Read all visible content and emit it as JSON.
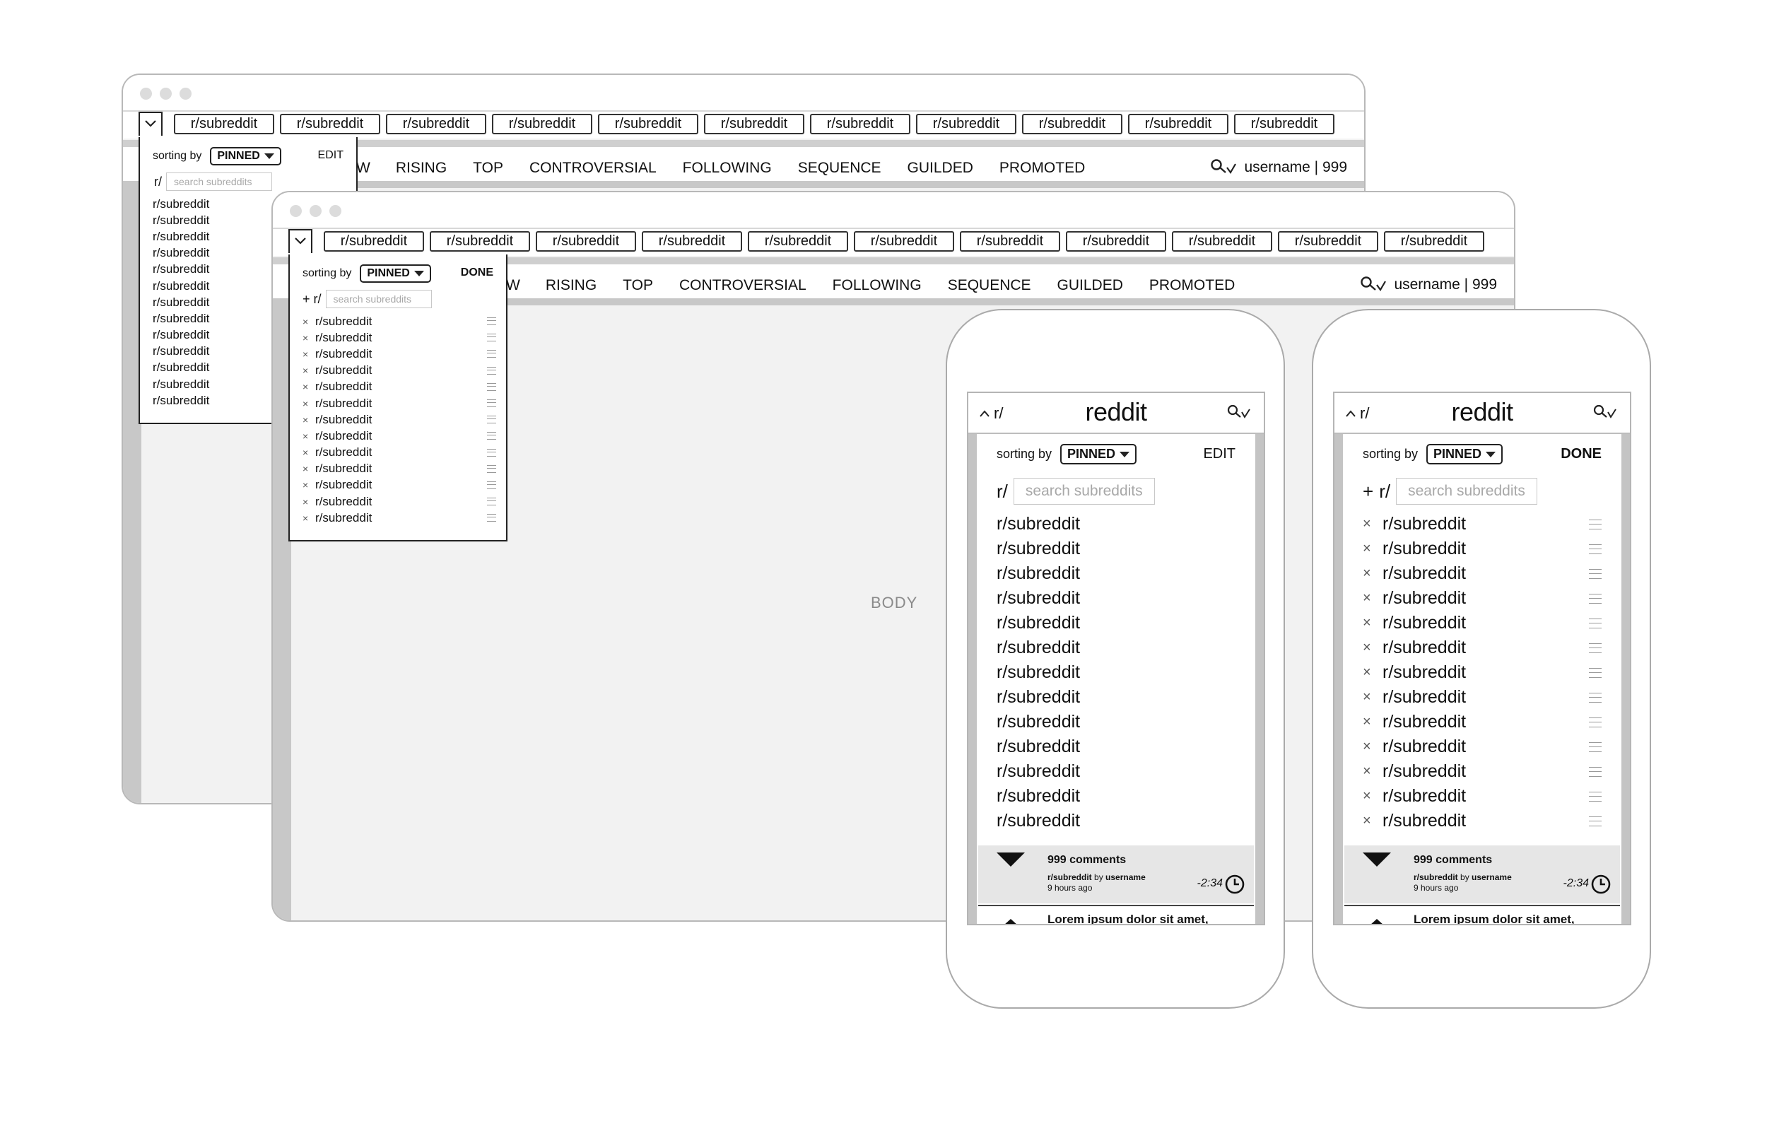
{
  "tabs": [
    "r/subreddit",
    "r/subreddit",
    "r/subreddit",
    "r/subreddit",
    "r/subreddit",
    "r/subreddit",
    "r/subreddit",
    "r/subreddit",
    "r/subreddit",
    "r/subreddit",
    "r/subreddit"
  ],
  "nav": [
    "RISING",
    "TOP",
    "CONTROVERSIAL",
    "FOLLOWING",
    "SEQUENCE",
    "GUILDED",
    "PROMOTED"
  ],
  "nav_partial": "W",
  "user_label": "username | 999",
  "body_label": "BODY",
  "dropdown": {
    "sorting_label": "sorting by",
    "sort_value": "PINNED",
    "edit_label": "EDIT",
    "done_label": "DONE",
    "prefix": "r/",
    "add_prefix": "+ r/",
    "add_icon": "+",
    "search_placeholder": "search subreddits",
    "items": [
      "r/subreddit",
      "r/subreddit",
      "r/subreddit",
      "r/subreddit",
      "r/subreddit",
      "r/subreddit",
      "r/subreddit",
      "r/subreddit",
      "r/subreddit",
      "r/subreddit",
      "r/subreddit",
      "r/subreddit",
      "r/subreddit"
    ]
  },
  "mobile": {
    "logo": "reddit",
    "r_label": "r/",
    "comments": "999 comments",
    "subreddit": "r/subreddit",
    "by": "by",
    "username": "username",
    "time_ago": "9 hours ago",
    "timer": "-2:34",
    "lorem": "Lorem ipsum dolor sit amet,"
  },
  "icons": [
    "chevron-down-icon",
    "chevron-up-icon",
    "key-icon",
    "caret-down-icon",
    "remove-icon",
    "drag-handle-icon",
    "clock-icon",
    "upvote-icon",
    "downvote-icon"
  ]
}
